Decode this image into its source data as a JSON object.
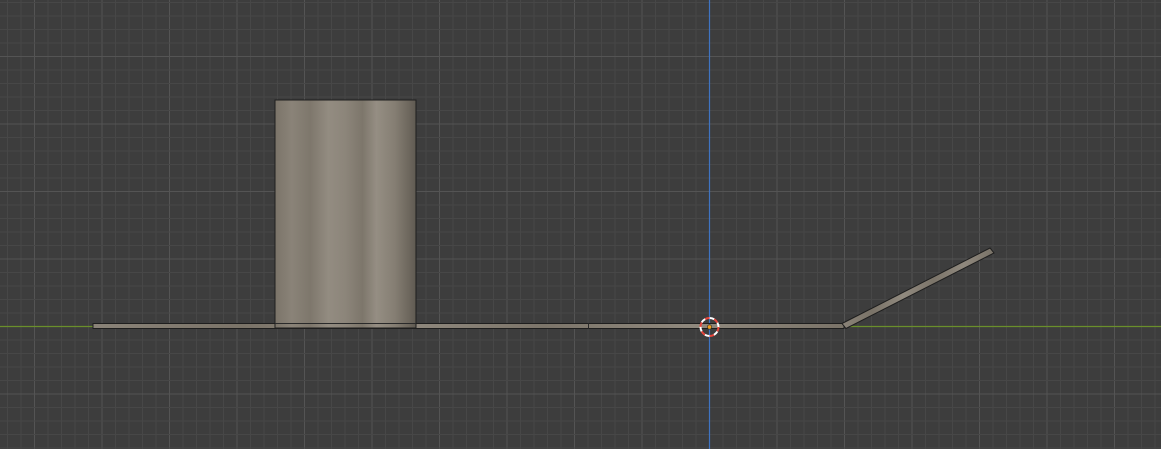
{
  "viewport": {
    "view": "orthographic-side",
    "background_color": "#3d3d3d",
    "grid_minor_color": "#474747",
    "grid_major_color": "#545454",
    "x_axis_color": "#6a8f2b",
    "z_axis_color": "#3f74c2"
  },
  "objects": [
    {
      "name": "box",
      "shape": "rectangle",
      "color": "#857d73"
    },
    {
      "name": "ground-plane",
      "shape": "thin-slab",
      "color": "#857d73"
    },
    {
      "name": "ramp",
      "shape": "angled-slab",
      "color": "#857d73"
    }
  ],
  "cursor": {
    "name": "3d-cursor",
    "ring_color_a": "#e8453c",
    "ring_color_b": "#ffffff",
    "origin_color": "#f0a020"
  }
}
